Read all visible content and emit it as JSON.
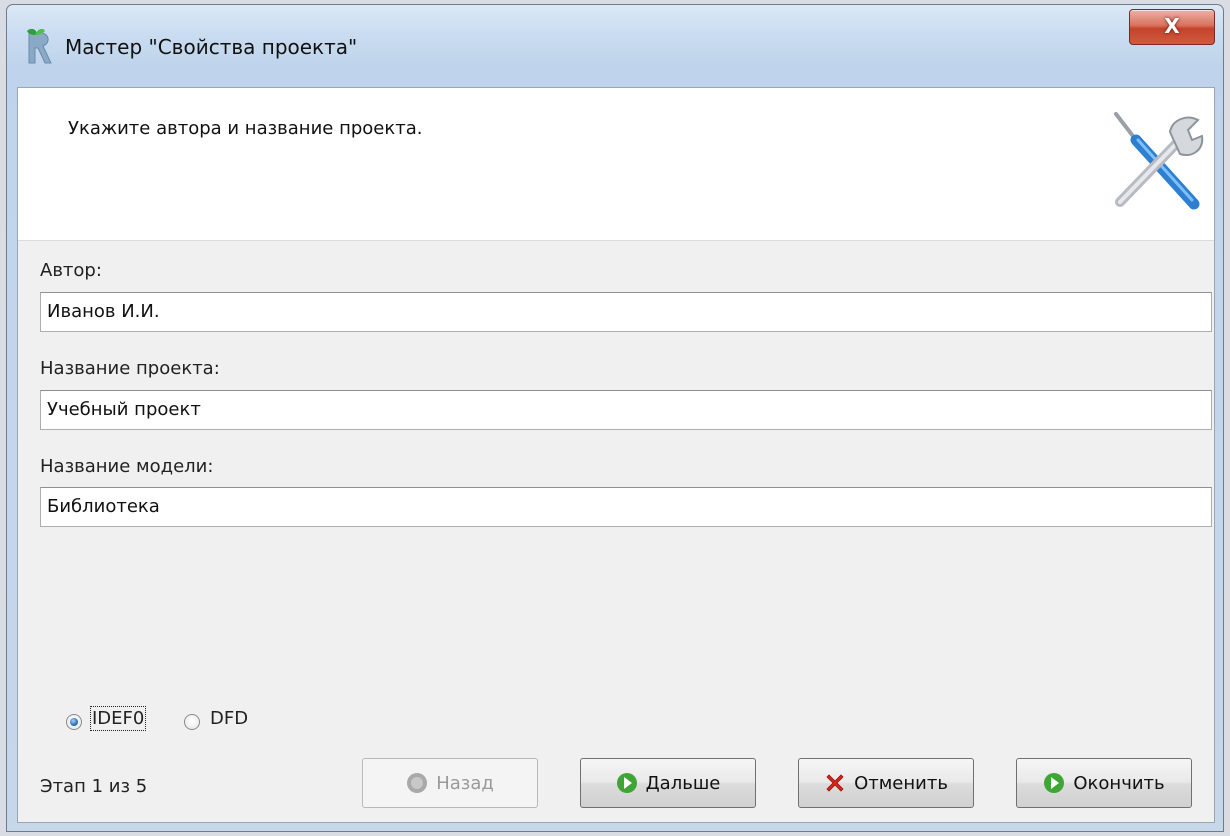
{
  "window": {
    "title": "Мастер \"Свойства проекта\"",
    "close_label": "X"
  },
  "header": {
    "instruction": "Укажите автора и название проекта."
  },
  "form": {
    "author_label": "Автор:",
    "author_value": "Иванов И.И.",
    "project_label": "Название проекта:",
    "project_value": "Учебный проект",
    "model_label": "Название модели:",
    "model_value": "Библиотека"
  },
  "notation": {
    "options": [
      {
        "label": "IDEF0",
        "checked": true
      },
      {
        "label": "DFD",
        "checked": false
      }
    ]
  },
  "footer": {
    "step_text": "Этап 1 из 5",
    "back_label": "Назад",
    "next_label": "Дальше",
    "cancel_label": "Отменить",
    "finish_label": "Окончить"
  },
  "colors": {
    "title_bar": "#c9dcf0",
    "close_button": "#c4432b",
    "client_bg": "#f0f0f0",
    "header_bg": "#ffffff",
    "go_icon": "#3fa535",
    "cancel_icon": "#d8261c"
  },
  "icons": {
    "app": "app-logo-icon",
    "header": "tools-wrench-screwdriver-icon",
    "back": "back-disabled-icon",
    "next": "next-go-icon",
    "cancel": "cancel-x-icon",
    "finish": "finish-go-icon"
  }
}
